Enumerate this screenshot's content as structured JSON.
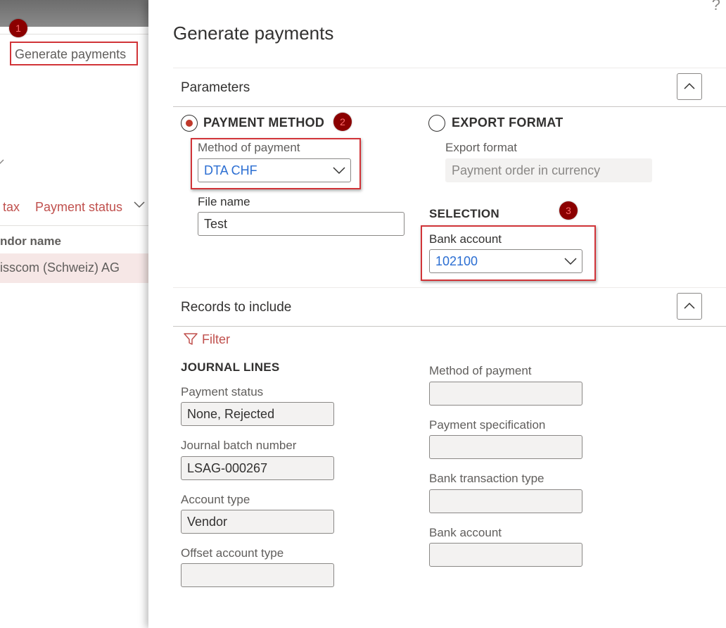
{
  "background": {
    "action_label": "Generate payments",
    "tax_col": "tax",
    "payment_status_col": "Payment status",
    "vendor_name_col": "ndor name",
    "row_vendor": "isscom (Schweiz) AG"
  },
  "badges": {
    "one": "1",
    "two": "2",
    "three": "3"
  },
  "panel": {
    "help": "?",
    "title": "Generate payments",
    "parameters": {
      "label": "Parameters",
      "payment_method_option": "PAYMENT METHOD",
      "export_format_option": "EXPORT FORMAT",
      "method_of_payment_label": "Method of payment",
      "method_of_payment_value": "DTA CHF",
      "file_name_label": "File name",
      "file_name_value": "Test",
      "export_format_label": "Export format",
      "export_format_value": "Payment order in currency",
      "selection_label": "SELECTION",
      "bank_account_label": "Bank account",
      "bank_account_value": "102100"
    },
    "records": {
      "label": "Records to include",
      "filter": "Filter",
      "journal_lines": "JOURNAL LINES",
      "payment_status_label": "Payment status",
      "payment_status_value": "None, Rejected",
      "journal_batch_label": "Journal batch number",
      "journal_batch_value": "LSAG-000267",
      "account_type_label": "Account type",
      "account_type_value": "Vendor",
      "offset_account_type_label": "Offset account type",
      "offset_account_type_value": "",
      "method_of_payment_label": "Method of payment",
      "method_of_payment_value": "",
      "payment_spec_label": "Payment specification",
      "payment_spec_value": "",
      "bank_txn_type_label": "Bank transaction type",
      "bank_txn_type_value": "",
      "bank_account_label": "Bank account",
      "bank_account_value": ""
    }
  },
  "colors": {
    "accent_red": "#d13438",
    "link_blue": "#2b6ed2",
    "badge": "#8b0000"
  }
}
